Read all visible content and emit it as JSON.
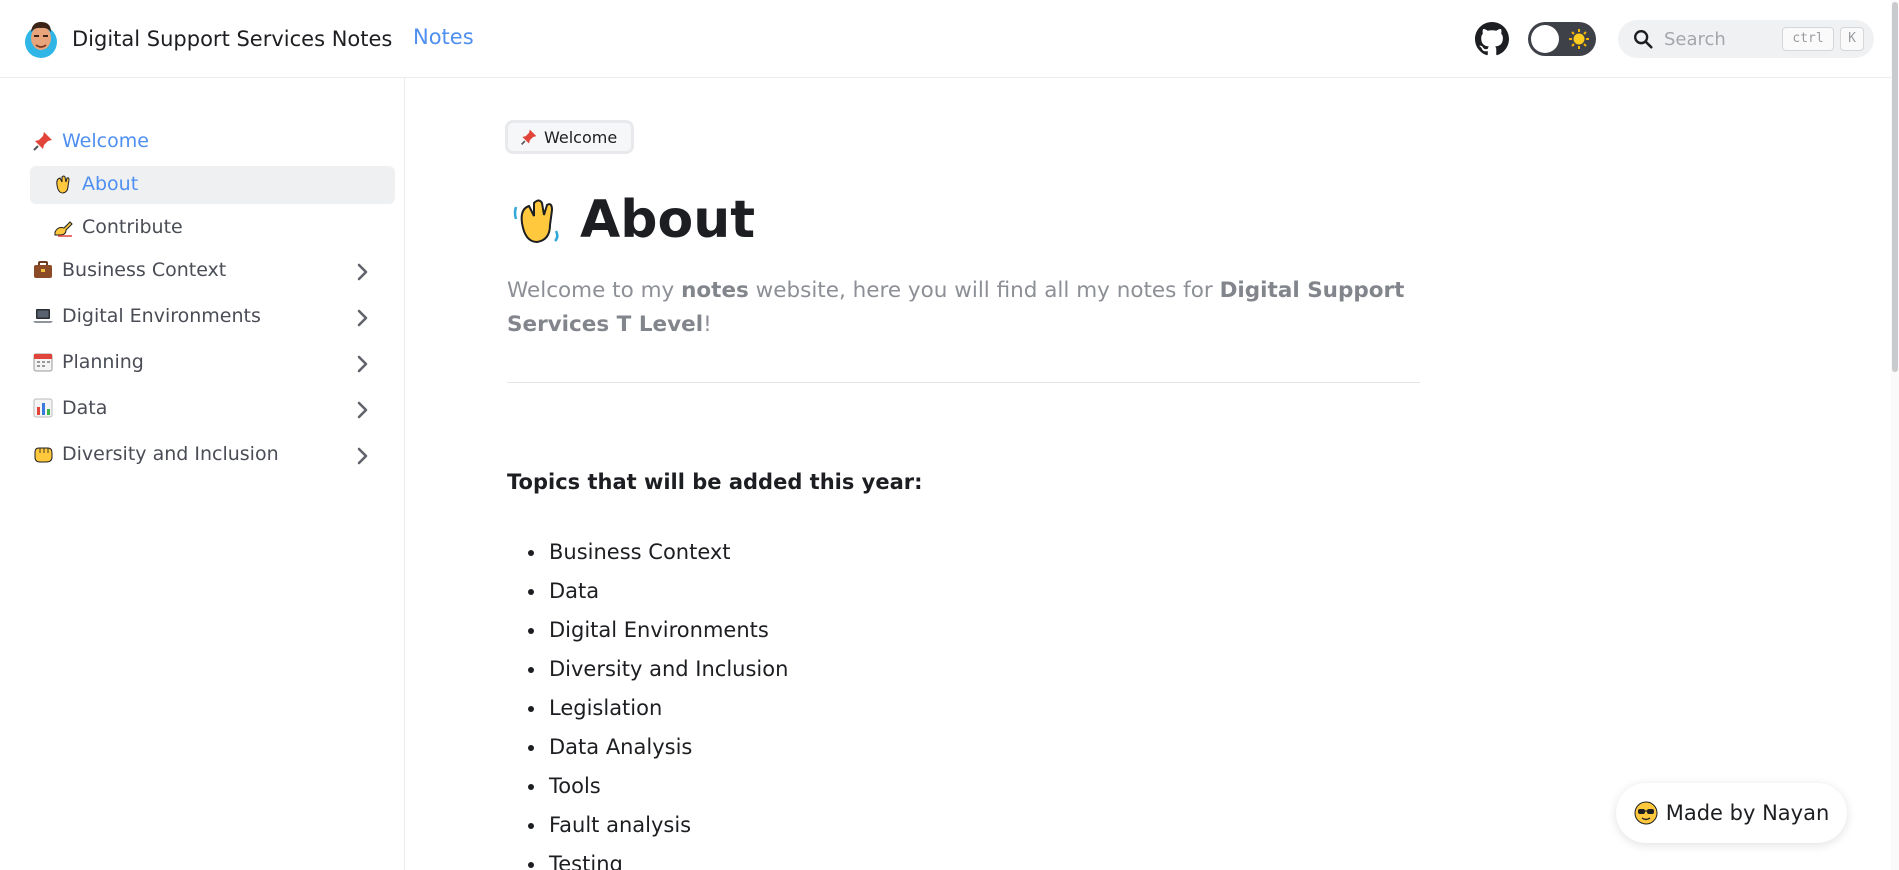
{
  "header": {
    "site_title": "Digital Support Services Notes",
    "nav_link": "Notes",
    "search_placeholder": "Search",
    "search_shortcut_1": "ctrl",
    "search_shortcut_2": "K",
    "github_icon": "github-icon",
    "theme_toggle_icon": "sun-icon"
  },
  "sidebar": {
    "items": [
      {
        "label": "Welcome",
        "icon": "pushpin-icon",
        "active": true
      },
      {
        "label": "About",
        "icon": "waving-hand-icon",
        "active": true
      },
      {
        "label": "Contribute",
        "icon": "writing-hand-icon",
        "active": false
      },
      {
        "label": "Business Context",
        "icon": "briefcase-icon",
        "active": false
      },
      {
        "label": "Digital Environments",
        "icon": "laptop-icon",
        "active": false
      },
      {
        "label": "Planning",
        "icon": "calendar-icon",
        "active": false
      },
      {
        "label": "Data",
        "icon": "bar-chart-icon",
        "active": false
      },
      {
        "label": "Diversity and Inclusion",
        "icon": "fist-icon",
        "active": false
      }
    ]
  },
  "main": {
    "breadcrumb": "Welcome",
    "title": "About",
    "intro": {
      "p1": "Welcome to my ",
      "b1": "notes",
      "p2": " website, here you will find all my notes for ",
      "b2": "Digital Support Services T Level",
      "p3": "!"
    },
    "topics_heading": "Topics that will be added this year:",
    "topics": [
      "Business Context",
      "Data",
      "Digital Environments",
      "Diversity and Inclusion",
      "Legislation",
      "Data Analysis",
      "Tools",
      "Fault analysis",
      "Testing"
    ]
  },
  "footer_badge": "Made by Nayan",
  "colors": {
    "accent": "#4e8ff0",
    "text": "#1c1e21",
    "muted": "#8c8f95",
    "active_bg": "#eff0f2"
  }
}
